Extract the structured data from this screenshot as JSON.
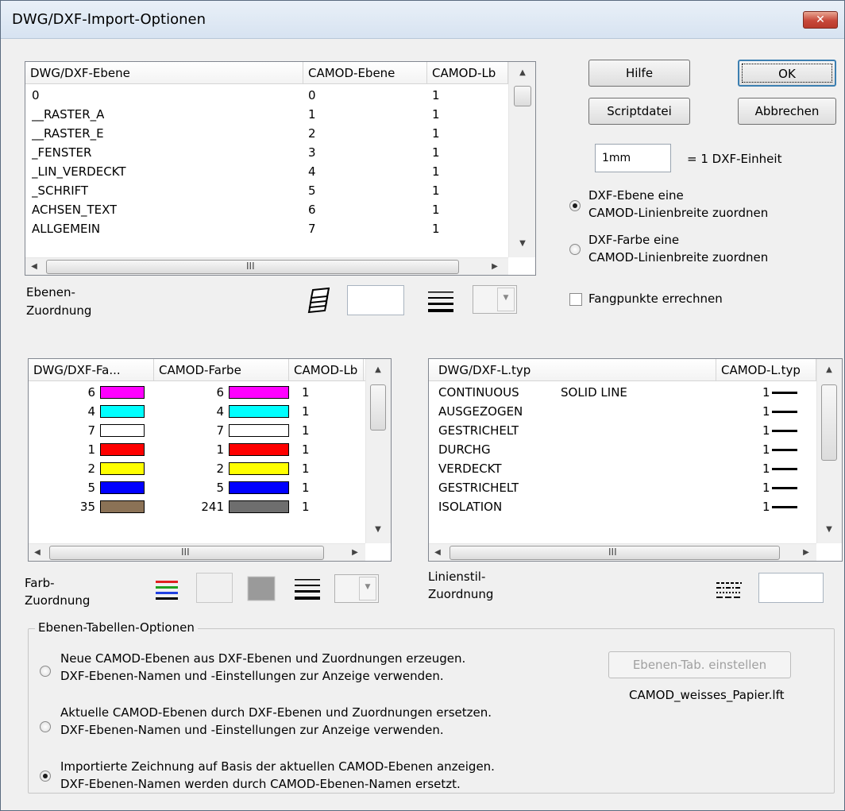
{
  "window": {
    "title": "DWG/DXF-Import-Optionen",
    "close_symbol": "✕"
  },
  "layer_list": {
    "headers": [
      "DWG/DXF-Ebene",
      "CAMOD-Ebene",
      "CAMOD-Lb"
    ],
    "rows": [
      [
        "0",
        "0",
        "1"
      ],
      [
        "__RASTER_A",
        "1",
        "1"
      ],
      [
        "__RASTER_E",
        "2",
        "1"
      ],
      [
        "_FENSTER",
        "3",
        "1"
      ],
      [
        "_LIN_VERDECKT",
        "4",
        "1"
      ],
      [
        "_SCHRIFT",
        "5",
        "1"
      ],
      [
        "ACHSEN_TEXT",
        "6",
        "1"
      ],
      [
        "ALLGEMEIN",
        "7",
        "1"
      ]
    ],
    "scroll_grip": "III"
  },
  "buttons": {
    "help": "Hilfe",
    "ok": "OK",
    "script": "Scriptdatei",
    "cancel": "Abbrechen",
    "layer_tab": "Ebenen-Tab. einstellen"
  },
  "unit": {
    "value": "1mm",
    "label": "= 1 DXF-Einheit"
  },
  "width_mode": {
    "option_layer_line1": "DXF-Ebene eine",
    "option_layer_line2": "CAMOD-Linienbreite zuordnen",
    "option_color_line1": "DXF-Farbe eine",
    "option_color_line2": "CAMOD-Linienbreite zuordnen",
    "selected": "layer"
  },
  "snap_points": {
    "label": "Fangpunkte errechnen",
    "checked": false
  },
  "layer_assign": {
    "line1": "Ebenen-",
    "line2": "Zuordnung"
  },
  "color_list": {
    "headers": [
      "DWG/DXF-Fa...",
      "CAMOD-Farbe",
      "CAMOD-Lb"
    ],
    "rows": [
      {
        "dxf": "6",
        "dxf_color": "#ff00ff",
        "camod": "6",
        "camod_color": "#ff00ff",
        "lb": "1"
      },
      {
        "dxf": "4",
        "dxf_color": "#00ffff",
        "camod": "4",
        "camod_color": "#00ffff",
        "lb": "1"
      },
      {
        "dxf": "7",
        "dxf_color": "#ffffff",
        "camod": "7",
        "camod_color": "#ffffff",
        "lb": "1"
      },
      {
        "dxf": "1",
        "dxf_color": "#ff0000",
        "camod": "1",
        "camod_color": "#ff0000",
        "lb": "1"
      },
      {
        "dxf": "2",
        "dxf_color": "#ffff00",
        "camod": "2",
        "camod_color": "#ffff00",
        "lb": "1"
      },
      {
        "dxf": "5",
        "dxf_color": "#0000ff",
        "camod": "5",
        "camod_color": "#0000ff",
        "lb": "1"
      },
      {
        "dxf": "35",
        "dxf_color": "#8b7256",
        "camod": "241",
        "camod_color": "#6e6e6e",
        "lb": "1"
      }
    ],
    "scroll_grip": "III"
  },
  "color_assign": {
    "line1": "Farb-",
    "line2": "Zuordnung"
  },
  "linetype_list": {
    "headers": [
      "DWG/DXF-L.typ",
      "CAMOD-L.typ"
    ],
    "rows": [
      {
        "name": "CONTINUOUS",
        "desc": "SOLID LINE",
        "val": "1"
      },
      {
        "name": "AUSGEZOGEN",
        "desc": "",
        "val": "1"
      },
      {
        "name": "GESTRICHELT",
        "desc": "",
        "val": "1"
      },
      {
        "name": "DURCHG",
        "desc": "",
        "val": "1"
      },
      {
        "name": "VERDECKT",
        "desc": "",
        "val": "1"
      },
      {
        "name": "GESTRICHELT",
        "desc": "",
        "val": "1"
      },
      {
        "name": "ISOLATION",
        "desc": "",
        "val": "1"
      }
    ],
    "scroll_grip": "III"
  },
  "linestyle_assign": {
    "line1": "Linienstil-",
    "line2": "Zuordnung"
  },
  "group": {
    "label": "Ebenen-Tabellen-Optionen",
    "opt1_line1": "Neue CAMOD-Ebenen aus DXF-Ebenen und Zuordnungen erzeugen.",
    "opt1_line2": "DXF-Ebenen-Namen und -Einstellungen zur Anzeige verwenden.",
    "opt2_line1": "Aktuelle CAMOD-Ebenen durch DXF-Ebenen und Zuordnungen ersetzen.",
    "opt2_line2": "DXF-Ebenen-Namen und -Einstellungen zur Anzeige verwenden.",
    "opt3_line1": "Importierte Zeichnung auf Basis der aktuellen CAMOD-Ebenen anzeigen.",
    "opt3_line2": "DXF-Ebenen-Namen werden durch CAMOD-Ebenen-Namen ersetzt.",
    "selected": 3,
    "file": "CAMOD_weisses_Papier.lft"
  }
}
